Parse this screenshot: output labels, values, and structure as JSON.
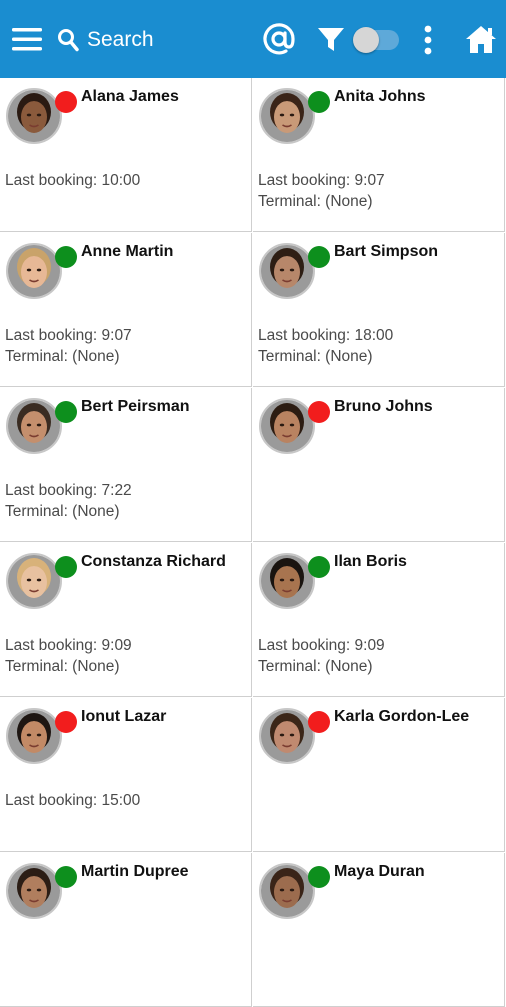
{
  "toolbar": {
    "menu_icon": "hamburger-menu-icon",
    "search_label": "Search",
    "at_icon": "at-sign-icon",
    "filter_icon": "filter-icon",
    "toggle_on": false,
    "more_icon": "more-vertical-icon",
    "home_icon": "home-icon"
  },
  "colors": {
    "toolbar": "#1a8dd0",
    "online": "#0d8f1d",
    "offline": "#f21d1d"
  },
  "people": [
    {
      "name": "Alana James",
      "status": "offline",
      "booking": "Last booking: 10:00",
      "terminal": ""
    },
    {
      "name": "Anita Johns",
      "status": "online",
      "booking": "Last booking: 9:07",
      "terminal": "Terminal: (None)"
    },
    {
      "name": "Anne Martin",
      "status": "online",
      "booking": "Last booking: 9:07",
      "terminal": "Terminal: (None)"
    },
    {
      "name": "Bart Simpson",
      "status": "online",
      "booking": "Last booking: 18:00",
      "terminal": "Terminal: (None)"
    },
    {
      "name": "Bert Peirsman",
      "status": "online",
      "booking": "Last booking: 7:22",
      "terminal": "Terminal: (None)"
    },
    {
      "name": "Bruno Johns",
      "status": "offline",
      "booking": "",
      "terminal": ""
    },
    {
      "name": "Constanza Richard",
      "status": "online",
      "booking": "Last booking: 9:09",
      "terminal": "Terminal: (None)"
    },
    {
      "name": "Ilan Boris",
      "status": "online",
      "booking": "Last booking: 9:09",
      "terminal": "Terminal: (None)"
    },
    {
      "name": "Ionut Lazar",
      "status": "offline",
      "booking": "Last booking: 15:00",
      "terminal": ""
    },
    {
      "name": "Karla Gordon-Lee",
      "status": "offline",
      "booking": "",
      "terminal": ""
    },
    {
      "name": "Martin Dupree",
      "status": "online",
      "booking": "",
      "terminal": ""
    },
    {
      "name": "Maya Duran",
      "status": "online",
      "booking": "",
      "terminal": ""
    }
  ]
}
